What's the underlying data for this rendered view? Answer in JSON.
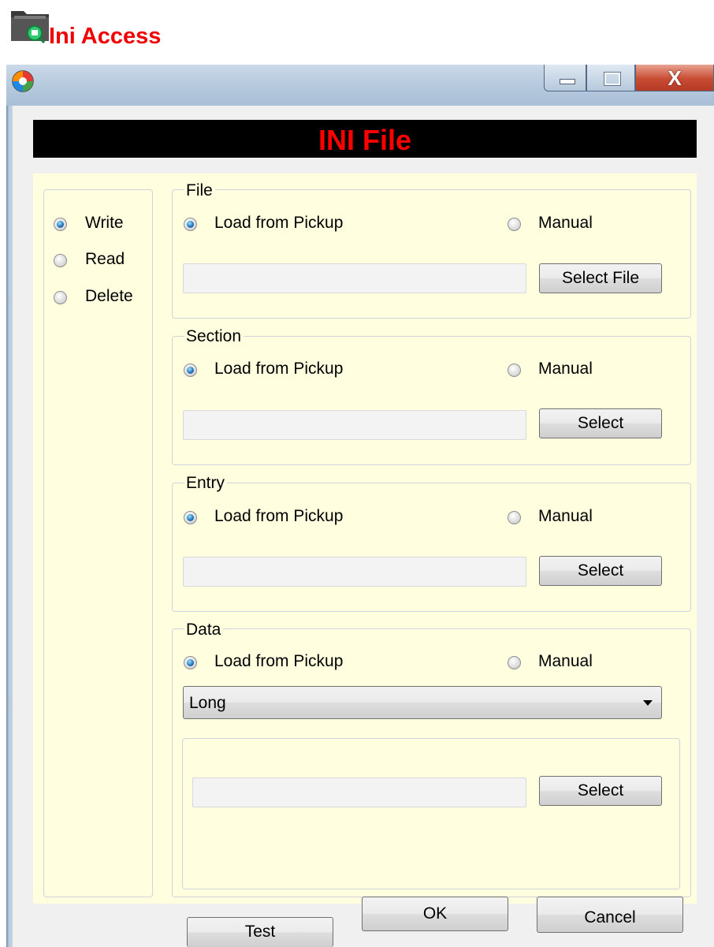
{
  "header": {
    "title": "Ini Access",
    "icon": "folder-search-icon"
  },
  "window": {
    "app_icon": "app-logo-icon",
    "controls": {
      "minimize_icon": "minimize-icon",
      "maximize_icon": "maximize-icon",
      "close_glyph": "X"
    }
  },
  "banner": {
    "title": "INI File"
  },
  "mode": {
    "options": [
      {
        "label": "Write",
        "checked": true
      },
      {
        "label": "Read",
        "checked": false
      },
      {
        "label": "Delete",
        "checked": false
      }
    ]
  },
  "file_group": {
    "legend": "File",
    "opt_pickup": "Load from Pickup",
    "opt_manual": "Manual",
    "value": "",
    "button": "Select File"
  },
  "section_group": {
    "legend": "Section",
    "opt_pickup": "Load from Pickup",
    "opt_manual": "Manual",
    "value": "",
    "button": "Select"
  },
  "entry_group": {
    "legend": "Entry",
    "opt_pickup": "Load from Pickup",
    "opt_manual": "Manual",
    "value": "",
    "button": "Select"
  },
  "data_group": {
    "legend": "Data",
    "opt_pickup": "Load from Pickup",
    "opt_manual": "Manual",
    "type_selected": "Long",
    "value": "",
    "button": "Select"
  },
  "footer": {
    "test": "Test",
    "ok": "OK",
    "cancel": "Cancel"
  },
  "colors": {
    "accent_red": "#f00000",
    "panel_yellow": "#ffffdf",
    "banner_bg": "#000000",
    "banner_text": "#ff0000"
  }
}
